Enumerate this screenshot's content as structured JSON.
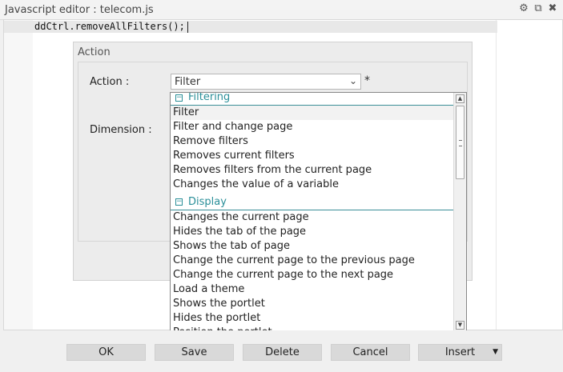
{
  "window": {
    "title": "Javascript editor : telecom.js"
  },
  "editor": {
    "code_line": "ddCtrl.removeAllFilters();"
  },
  "action_panel": {
    "legend": "Action",
    "action_label": "Action :",
    "dimension_label": "Dimension :",
    "action_select_value": "Filter",
    "required_marker": "*"
  },
  "dropdown": {
    "groups": [
      {
        "label": "Filtering",
        "options": [
          "Filter",
          "Filter and change page",
          "Remove filters",
          "Removes current filters",
          "Removes filters from the current page",
          "Changes the value of a variable"
        ]
      },
      {
        "label": "Display",
        "options": [
          "Changes the current page",
          "Hides the tab of the page",
          "Shows the tab of page",
          "Change the current page to the previous page",
          "Change the current page to the next page",
          "Load a theme",
          "Shows the portlet",
          "Hides the portlet",
          "Position the portlet"
        ]
      }
    ]
  },
  "footer": {
    "ok": "OK",
    "save": "Save",
    "delete": "Delete",
    "cancel": "Cancel",
    "insert": "Insert"
  },
  "icons": {
    "settings": "gear-icon",
    "popout": "external-window-icon",
    "close": "close-icon"
  }
}
